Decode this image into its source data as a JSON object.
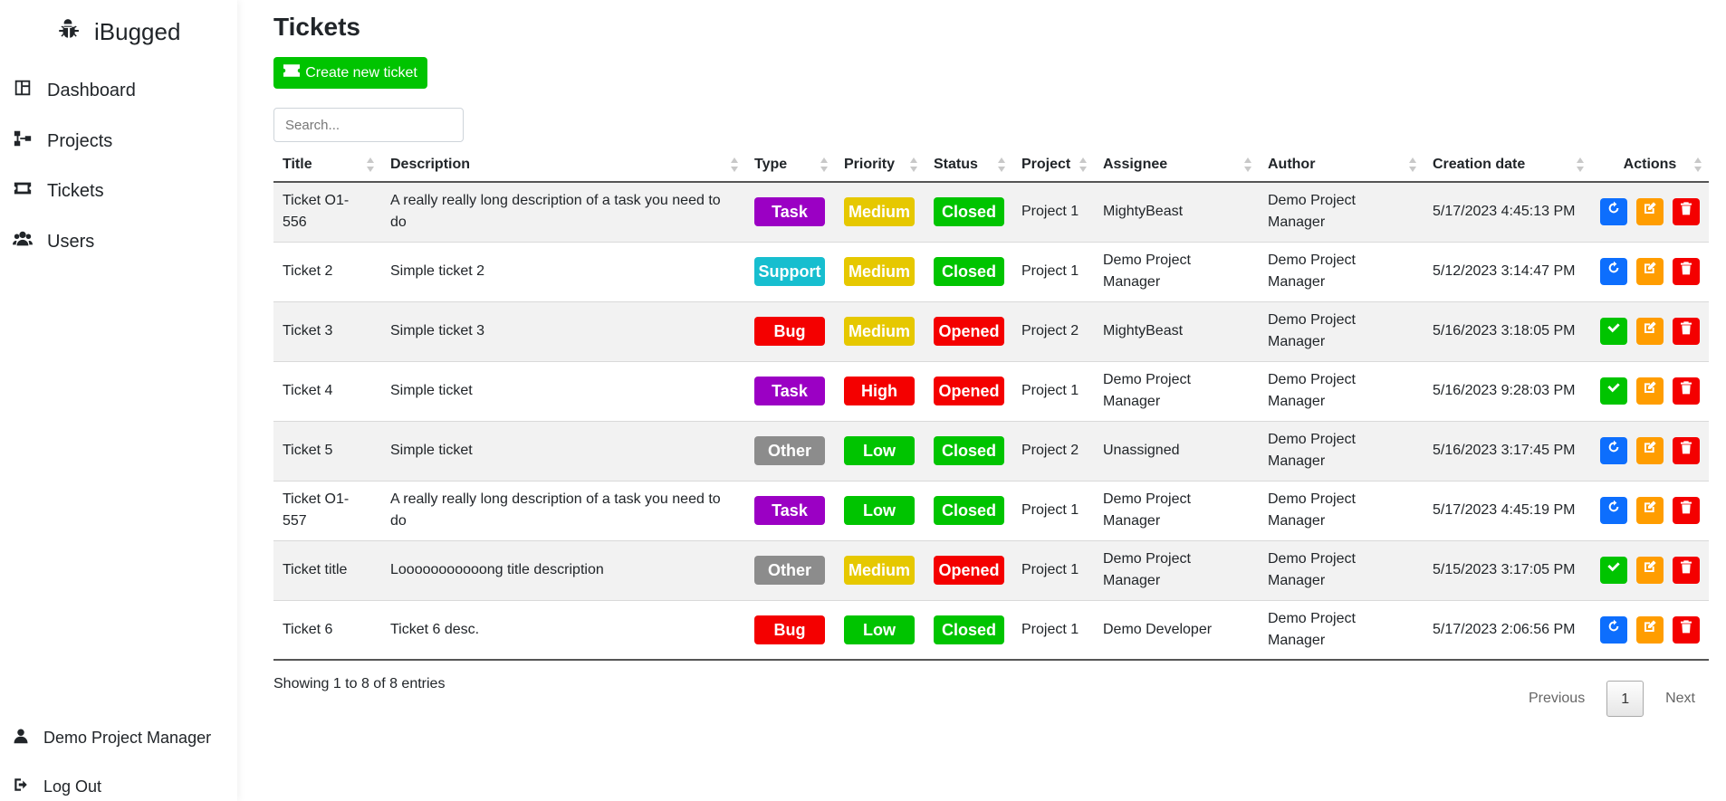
{
  "sidebar": {
    "brand": "iBugged",
    "nav": [
      {
        "label": "Dashboard"
      },
      {
        "label": "Projects"
      },
      {
        "label": "Tickets"
      },
      {
        "label": "Users"
      }
    ],
    "user": "Demo Project Manager",
    "logout": "Log Out"
  },
  "main": {
    "title": "Tickets",
    "create_label": "Create new ticket",
    "search_placeholder": "Search...",
    "columns": [
      "Title",
      "Description",
      "Type",
      "Priority",
      "Status",
      "Project",
      "Assignee",
      "Author",
      "Creation date",
      "Actions"
    ],
    "rows": [
      {
        "title": "Ticket O1-556",
        "description": "A really really long description of a task you need to do",
        "type": "Task",
        "priority": "Medium",
        "status": "Closed",
        "project": "Project 1",
        "assignee": "MightyBeast",
        "author": "Demo Project Manager",
        "date": "5/17/2023 4:45:13 PM"
      },
      {
        "title": "Ticket 2",
        "description": "Simple ticket 2",
        "type": "Support",
        "priority": "Medium",
        "status": "Closed",
        "project": "Project 1",
        "assignee": "Demo Project Manager",
        "author": "Demo Project Manager",
        "date": "5/12/2023 3:14:47 PM"
      },
      {
        "title": "Ticket 3",
        "description": "Simple ticket 3",
        "type": "Bug",
        "priority": "Medium",
        "status": "Opened",
        "project": "Project 2",
        "assignee": "MightyBeast",
        "author": "Demo Project Manager",
        "date": "5/16/2023 3:18:05 PM"
      },
      {
        "title": "Ticket 4",
        "description": "Simple ticket",
        "type": "Task",
        "priority": "High",
        "status": "Opened",
        "project": "Project 1",
        "assignee": "Demo Project Manager",
        "author": "Demo Project Manager",
        "date": "5/16/2023 9:28:03 PM"
      },
      {
        "title": "Ticket 5",
        "description": "Simple ticket",
        "type": "Other",
        "priority": "Low",
        "status": "Closed",
        "project": "Project 2",
        "assignee": "Unassigned",
        "author": "Demo Project Manager",
        "date": "5/16/2023 3:17:45 PM"
      },
      {
        "title": "Ticket O1-557",
        "description": "A really really long description of a task you need to do",
        "type": "Task",
        "priority": "Low",
        "status": "Closed",
        "project": "Project 1",
        "assignee": "Demo Project Manager",
        "author": "Demo Project Manager",
        "date": "5/17/2023 4:45:19 PM"
      },
      {
        "title": "Ticket title",
        "description": "Looooooooooong title description",
        "type": "Other",
        "priority": "Medium",
        "status": "Opened",
        "project": "Project 1",
        "assignee": "Demo Project Manager",
        "author": "Demo Project Manager",
        "date": "5/15/2023 3:17:05 PM"
      },
      {
        "title": "Ticket 6",
        "description": "Ticket 6 desc.",
        "type": "Bug",
        "priority": "Low",
        "status": "Closed",
        "project": "Project 1",
        "assignee": "Demo Developer",
        "author": "Demo Project Manager",
        "date": "5/17/2023 2:06:56 PM"
      }
    ],
    "info": "Showing 1 to 8 of 8 entries",
    "pagination": {
      "previous": "Previous",
      "page": "1",
      "next": "Next"
    }
  },
  "colors": {
    "Task": "#9b00c4",
    "Support": "#17becf",
    "Bug": "#f40000",
    "Other": "#8c8c8c",
    "Medium": "#e6c800",
    "High": "#f40000",
    "Low": "#00c400",
    "Closed": "#00c400",
    "Opened": "#f40000",
    "accent": "#00c400"
  }
}
